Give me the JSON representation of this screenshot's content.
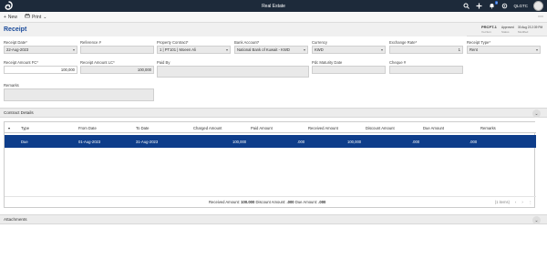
{
  "topbar": {
    "title": "Real Estate",
    "org": "QLGTC",
    "notification_count": "3"
  },
  "toolbar": {
    "new_label": "New",
    "print_label": "Print"
  },
  "page": {
    "title": "Receipt"
  },
  "record": {
    "number": "PRCPT-1",
    "number_sub": "Vo-Num",
    "status": "Approved",
    "status_sub": "Status",
    "date": "30 Aug 23 2:39 PM",
    "date_sub": "Modified"
  },
  "form": {
    "receipt_date": {
      "label": "Receipt Date*",
      "value": "22-Aug-2023"
    },
    "reference": {
      "label": "Reference #",
      "value": ""
    },
    "property_contract": {
      "label": "Property Contract*",
      "value": "1 | PT101 | Moeen Ali"
    },
    "bank_account": {
      "label": "Bank Account*",
      "value": "National Bank of Kuwait - KWD"
    },
    "currency": {
      "label": "Currency",
      "value": "KWD"
    },
    "exchange_rate": {
      "label": "Exchange Rate*",
      "value": "1"
    },
    "receipt_type": {
      "label": "Receipt Type*",
      "value": "Rent"
    },
    "amount_fc": {
      "label": "Receipt Amount FC*",
      "value": "100,000"
    },
    "amount_lc": {
      "label": "Receipt Amount LC*",
      "value": "100,000"
    },
    "paid_by": {
      "label": "Paid By",
      "value": ""
    },
    "pdc_maturity": {
      "label": "Pdc Maturity Date",
      "value": ""
    },
    "cheque": {
      "label": "Cheque #",
      "value": ""
    },
    "remarks": {
      "label": "Remarks",
      "value": ""
    }
  },
  "contract": {
    "section_title": "Contract Details",
    "columns": [
      "Type",
      "From Date",
      "To Date",
      "Charged Amount",
      "Paid Amount",
      "Received Amount",
      "Discount Amount",
      "Due Amount",
      "Remarks"
    ],
    "row": {
      "type": "Due",
      "from": "01-Aug-2023",
      "to": "31-Aug-2023",
      "charged": "100,000",
      "paid": ".000",
      "received": "100,000",
      "discount": ".000",
      "due": ".000",
      "remarks": ""
    },
    "totals_received_label": "Received Amount:",
    "totals_received": "100.000",
    "totals_discount_label": "Discount Amount:",
    "totals_discount": ".000",
    "totals_due_label": "Due Amount:",
    "totals_due": ".000",
    "items_count": "(1 items)"
  },
  "attachments": {
    "section_title": "Attachments"
  }
}
